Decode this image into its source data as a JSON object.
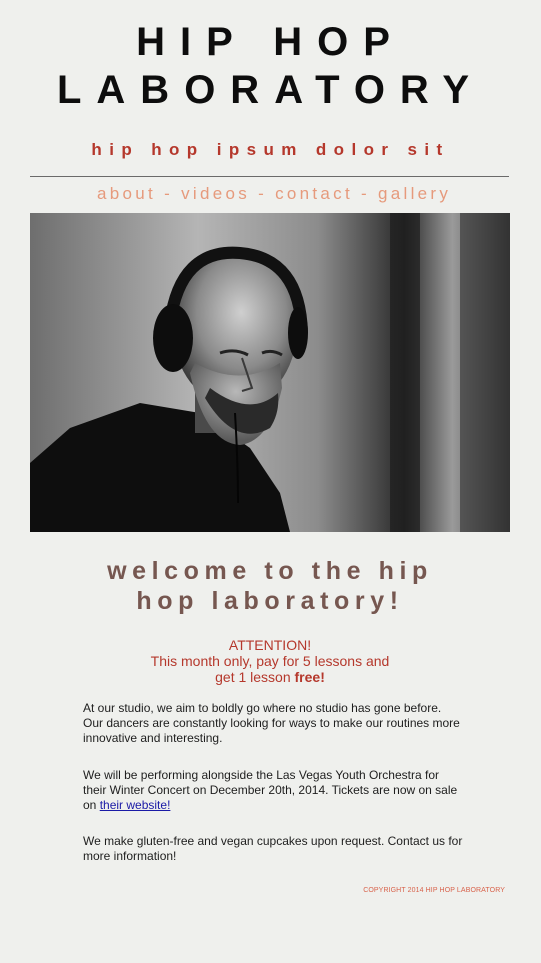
{
  "header": {
    "title_line1": "HIP HOP",
    "title_line2": "LABORATORY",
    "tagline": "hip hop ipsum dolor sit"
  },
  "nav": {
    "items": [
      "about",
      "videos",
      "contact",
      "gallery"
    ],
    "separator": "-"
  },
  "colors": {
    "background": "#eff0ed",
    "title": "#0d0d0d",
    "accent_red": "#b5382c",
    "nav": "#e69a7c",
    "welcome": "#765750",
    "link": "#1a1aa6"
  },
  "main": {
    "welcome_line1": "welcome to the hip",
    "welcome_line2": "hop laboratory!",
    "attention": {
      "heading": "ATTENTION!",
      "line2": "This month only, pay for 5 lessons and",
      "line3_prefix": "get 1 lesson",
      "line3_bold": "free!"
    },
    "paragraph1": "At our studio, we aim to boldly go where no studio has gone before. Our dancers are constantly looking for ways to make our routines more innovative and interesting.",
    "paragraph2_text": "We will be performing alongside the Las Vegas Youth Orchestra for their Winter Concert on December 20th, 2014. Tickets are now on sale on",
    "paragraph2_link": "their website!",
    "paragraph3": "We make gluten-free and vegan cupcakes upon request. Contact us for more information!"
  },
  "footer": {
    "copyright": "COPYRIGHT 2014 HIP HOP LABORATORY"
  }
}
